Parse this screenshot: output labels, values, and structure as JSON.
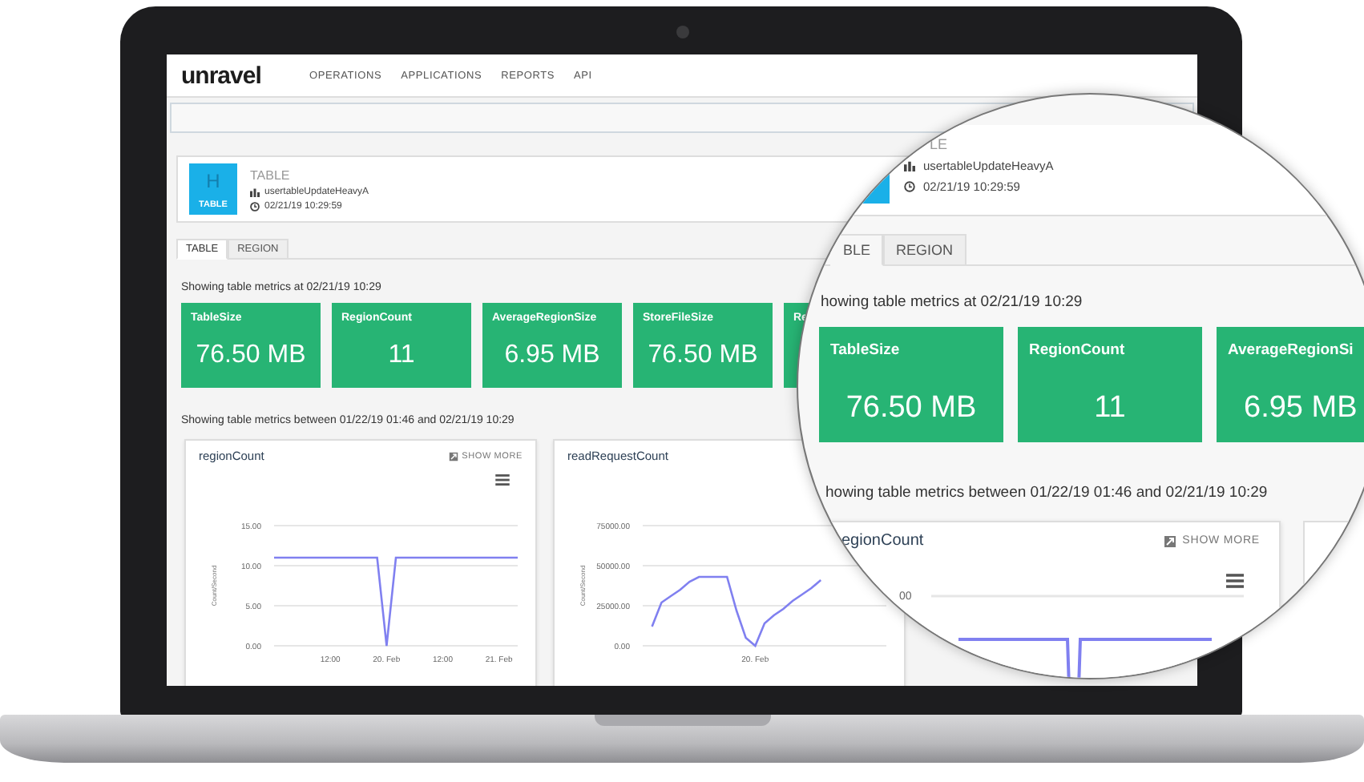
{
  "nav": {
    "logo": "unravel",
    "items": [
      "OPERATIONS",
      "APPLICATIONS",
      "REPORTS",
      "API"
    ]
  },
  "entity": {
    "badge_letter": "H",
    "badge_label": "TABLE",
    "type": "TABLE",
    "name": "usertableUpdateHeavyA",
    "timestamp": "02/21/19 10:29:59"
  },
  "tabs": [
    {
      "label": "TABLE",
      "selected": true
    },
    {
      "label": "REGION",
      "selected": false
    }
  ],
  "current_caption": "Showing table metrics at 02/21/19 10:29",
  "metric_tiles": [
    {
      "label": "TableSize",
      "value": "76.50 MB"
    },
    {
      "label": "RegionCount",
      "value": "11"
    },
    {
      "label": "AverageRegionSize",
      "value": "6.95 MB"
    },
    {
      "label": "StoreFileSize",
      "value": "76.50 MB"
    },
    {
      "label": "Re"
    }
  ],
  "range_caption": "Showing table metrics between 01/22/19 01:46 and 02/21/19 10:29",
  "charts": [
    {
      "show_more": "SHOW MORE",
      "chart_data": {
        "type": "line",
        "title": "regionCount",
        "ylabel": "Count/Second",
        "categories": [
          null,
          null,
          null,
          null,
          null,
          null,
          "12:00",
          null,
          null,
          null,
          null,
          null,
          "20. Feb",
          null,
          null,
          null,
          null,
          null,
          "12:00",
          null,
          null,
          null,
          null,
          null,
          "21. Feb",
          null,
          null
        ],
        "series": [
          {
            "color": "#8080f0",
            "values": [
              11,
              11,
              11,
              11,
              11,
              11,
              11,
              11,
              11,
              11,
              11,
              11,
              0,
              11,
              11,
              11,
              11,
              11,
              11,
              11,
              11,
              11,
              11,
              11,
              11,
              11,
              11
            ]
          }
        ],
        "ylim": [
          0,
          15
        ],
        "yticks": [
          {
            "value": 0,
            "label": "0.00"
          },
          {
            "value": 5,
            "label": "5.00"
          },
          {
            "value": 10,
            "label": "10.00"
          },
          {
            "value": 15,
            "label": "15.00"
          }
        ]
      }
    },
    {
      "chart_data": {
        "type": "line",
        "title": "readRequestCount",
        "ylabel": "Count/Second",
        "categories": [
          null,
          null,
          null,
          null,
          null,
          null,
          null,
          null,
          null,
          null,
          null,
          null,
          "20. Feb",
          null,
          null,
          null,
          null,
          null,
          null,
          null,
          null,
          null,
          null,
          null,
          null,
          null,
          null
        ],
        "series": [
          {
            "color": "#8080f0",
            "values": [
              null,
              12000,
              27000,
              31000,
              35000,
              40000,
              43000,
              43000,
              43000,
              43000,
              22000,
              5000,
              0,
              14000,
              19000,
              23000,
              28000,
              32000,
              36000,
              41000,
              null,
              null,
              null,
              null,
              null,
              null,
              null
            ]
          }
        ],
        "ylim": [
          0,
          75000
        ],
        "yticks": [
          {
            "value": 0,
            "label": "0.00"
          },
          {
            "value": 25000,
            "label": "25000.00"
          },
          {
            "value": 50000,
            "label": "50000.00"
          },
          {
            "value": 75000,
            "label": "75000.00"
          }
        ]
      }
    }
  ],
  "magnifier": {
    "entity_type": "LE",
    "name": "usertableUpdateHeavyA",
    "timestamp": "02/21/19 10:29:59",
    "tabs": [
      {
        "label": "BLE",
        "selected": true
      },
      {
        "label": "REGION",
        "selected": false
      }
    ],
    "current_caption": "howing table metrics at 02/21/19 10:29",
    "metric_tiles": [
      {
        "label": "TableSize",
        "value": "76.50 MB"
      },
      {
        "label": "RegionCount",
        "value": "11"
      },
      {
        "label": "AverageRegionSi",
        "value": "6.95 MB"
      }
    ],
    "range_caption": "howing table metrics between 01/22/19 01:46 and 02/21/19 10:29",
    "chart": {
      "title": "egionCount",
      "show_more": "SHOW MORE",
      "axis_label": "00"
    }
  }
}
